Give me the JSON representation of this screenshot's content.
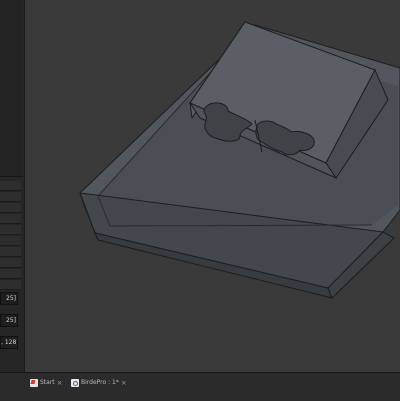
{
  "sidebar": {
    "fields": [
      "25]",
      "25]",
      ", 128]"
    ]
  },
  "taskbar": {
    "tabs": [
      {
        "label": "Start",
        "close": "×"
      },
      {
        "label": "BirdePro : 1*",
        "close": "×"
      }
    ]
  },
  "colors": {
    "background": "#3a3a3a",
    "model_fill": "#4c5157",
    "model_edges": "#1c1d1f"
  }
}
